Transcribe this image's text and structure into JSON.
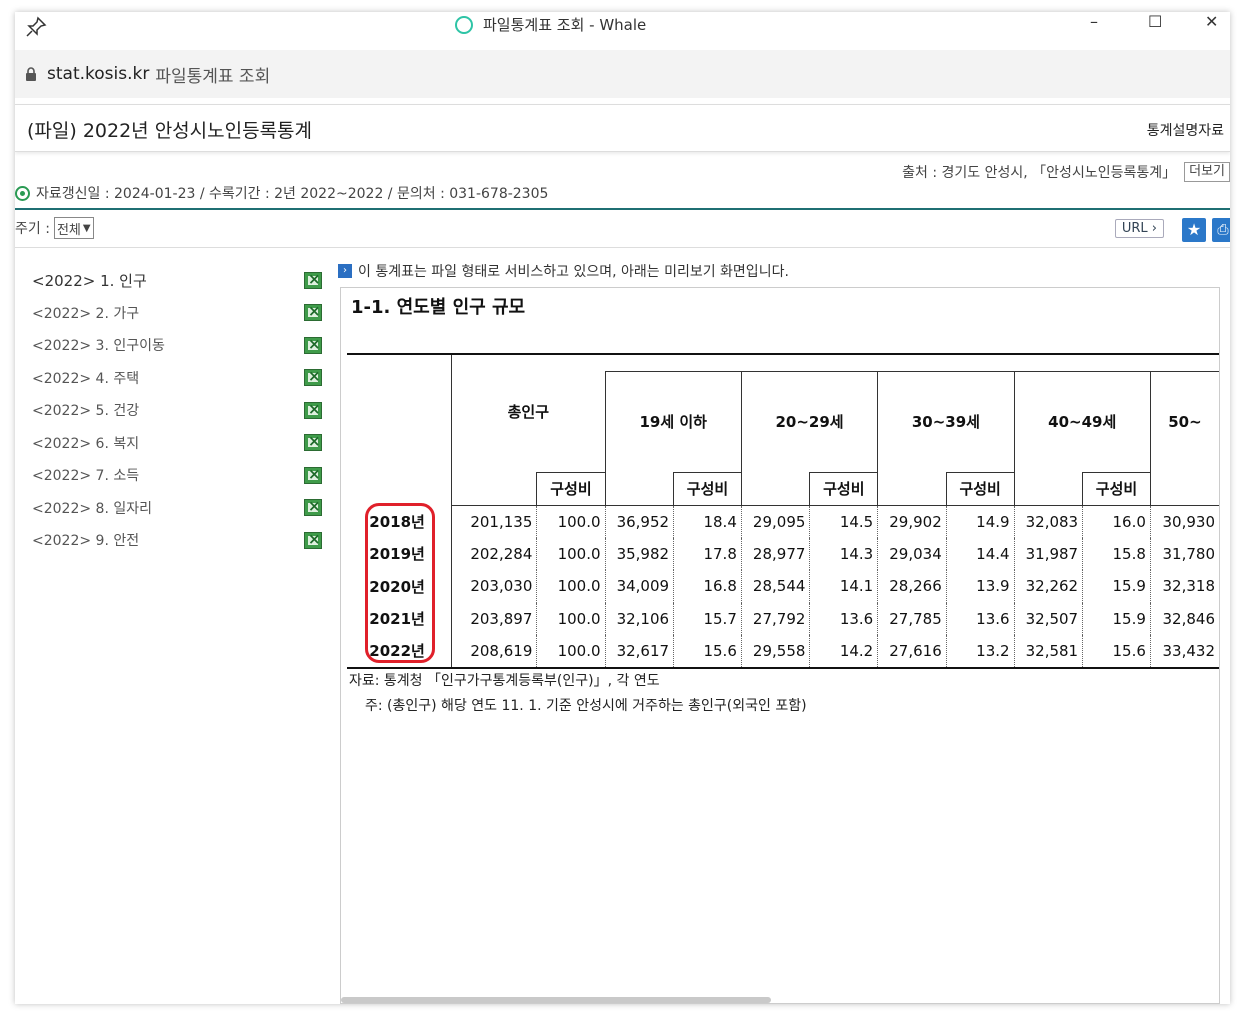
{
  "window": {
    "title": "파일통계표 조회 - Whale",
    "minimize": "–",
    "maximize": "☐",
    "close": "✕"
  },
  "address": {
    "domain": "stat.kosis.kr",
    "page_title": "파일통계표 조회"
  },
  "header": {
    "title": "(파일) 2022년 안성시노인등록통계",
    "explain_link": "통계설명자료"
  },
  "source": {
    "text": "출처 : 경기도 안성시, 「안성시노인등록통계」",
    "more_button": "더보기"
  },
  "meta": {
    "text": "자료갱신일 : 2024-01-23 / 수록기간 : 2년 2022~2022 / 문의처 : 031-678-2305"
  },
  "period": {
    "label": "주기 :",
    "selected": "전체"
  },
  "toolbar": {
    "url_label": "URL ›",
    "star_icon": "★",
    "print_icon": "⎙"
  },
  "sidebar": {
    "items": [
      {
        "label": "<2022> 1. 인구"
      },
      {
        "label": "<2022> 2. 가구"
      },
      {
        "label": "<2022> 3. 인구이동"
      },
      {
        "label": "<2022> 4. 주택"
      },
      {
        "label": "<2022> 5. 건강"
      },
      {
        "label": "<2022> 6. 복지"
      },
      {
        "label": "<2022> 7. 소득"
      },
      {
        "label": "<2022> 8. 일자리"
      },
      {
        "label": "<2022> 9. 안전"
      }
    ]
  },
  "preview": {
    "notice": "이 통계표는 파일 형태로 서비스하고 있으며, 아래는 미리보기 화면입니다.",
    "table_title": "1-1. 연도별 인구 규모",
    "headers": {
      "total": "총인구",
      "g1": "19세 이하",
      "g2": "20~29세",
      "g3": "30~39세",
      "g4": "40~49세",
      "g5": "50~",
      "ratio": "구성비"
    },
    "rows": [
      {
        "year": "2018년",
        "total": "201,135",
        "total_r": "100.0",
        "g1": "36,952",
        "g1_r": "18.4",
        "g2": "29,095",
        "g2_r": "14.5",
        "g3": "29,902",
        "g3_r": "14.9",
        "g4": "32,083",
        "g4_r": "16.0",
        "g5": "30,930"
      },
      {
        "year": "2019년",
        "total": "202,284",
        "total_r": "100.0",
        "g1": "35,982",
        "g1_r": "17.8",
        "g2": "28,977",
        "g2_r": "14.3",
        "g3": "29,034",
        "g3_r": "14.4",
        "g4": "31,987",
        "g4_r": "15.8",
        "g5": "31,780"
      },
      {
        "year": "2020년",
        "total": "203,030",
        "total_r": "100.0",
        "g1": "34,009",
        "g1_r": "16.8",
        "g2": "28,544",
        "g2_r": "14.1",
        "g3": "28,266",
        "g3_r": "13.9",
        "g4": "32,262",
        "g4_r": "15.9",
        "g5": "32,318"
      },
      {
        "year": "2021년",
        "total": "203,897",
        "total_r": "100.0",
        "g1": "32,106",
        "g1_r": "15.7",
        "g2": "27,792",
        "g2_r": "13.6",
        "g3": "27,785",
        "g3_r": "13.6",
        "g4": "32,507",
        "g4_r": "15.9",
        "g5": "32,846"
      },
      {
        "year": "2022년",
        "total": "208,619",
        "total_r": "100.0",
        "g1": "32,617",
        "g1_r": "15.6",
        "g2": "29,558",
        "g2_r": "14.2",
        "g3": "27,616",
        "g3_r": "13.2",
        "g4": "32,581",
        "g4_r": "15.6",
        "g5": "33,432"
      }
    ],
    "footnote_source": "자료: 통계청 「인구가구통계등록부(인구)」, 각 연도",
    "footnote_note": "주: (총인구) 해당 연도 11. 1. 기준 안성시에 거주하는 총인구(외국인 포함)"
  },
  "colors": {
    "accent": "#1f6f73",
    "highlight": "#e0202a",
    "button_blue": "#2b78c9"
  }
}
